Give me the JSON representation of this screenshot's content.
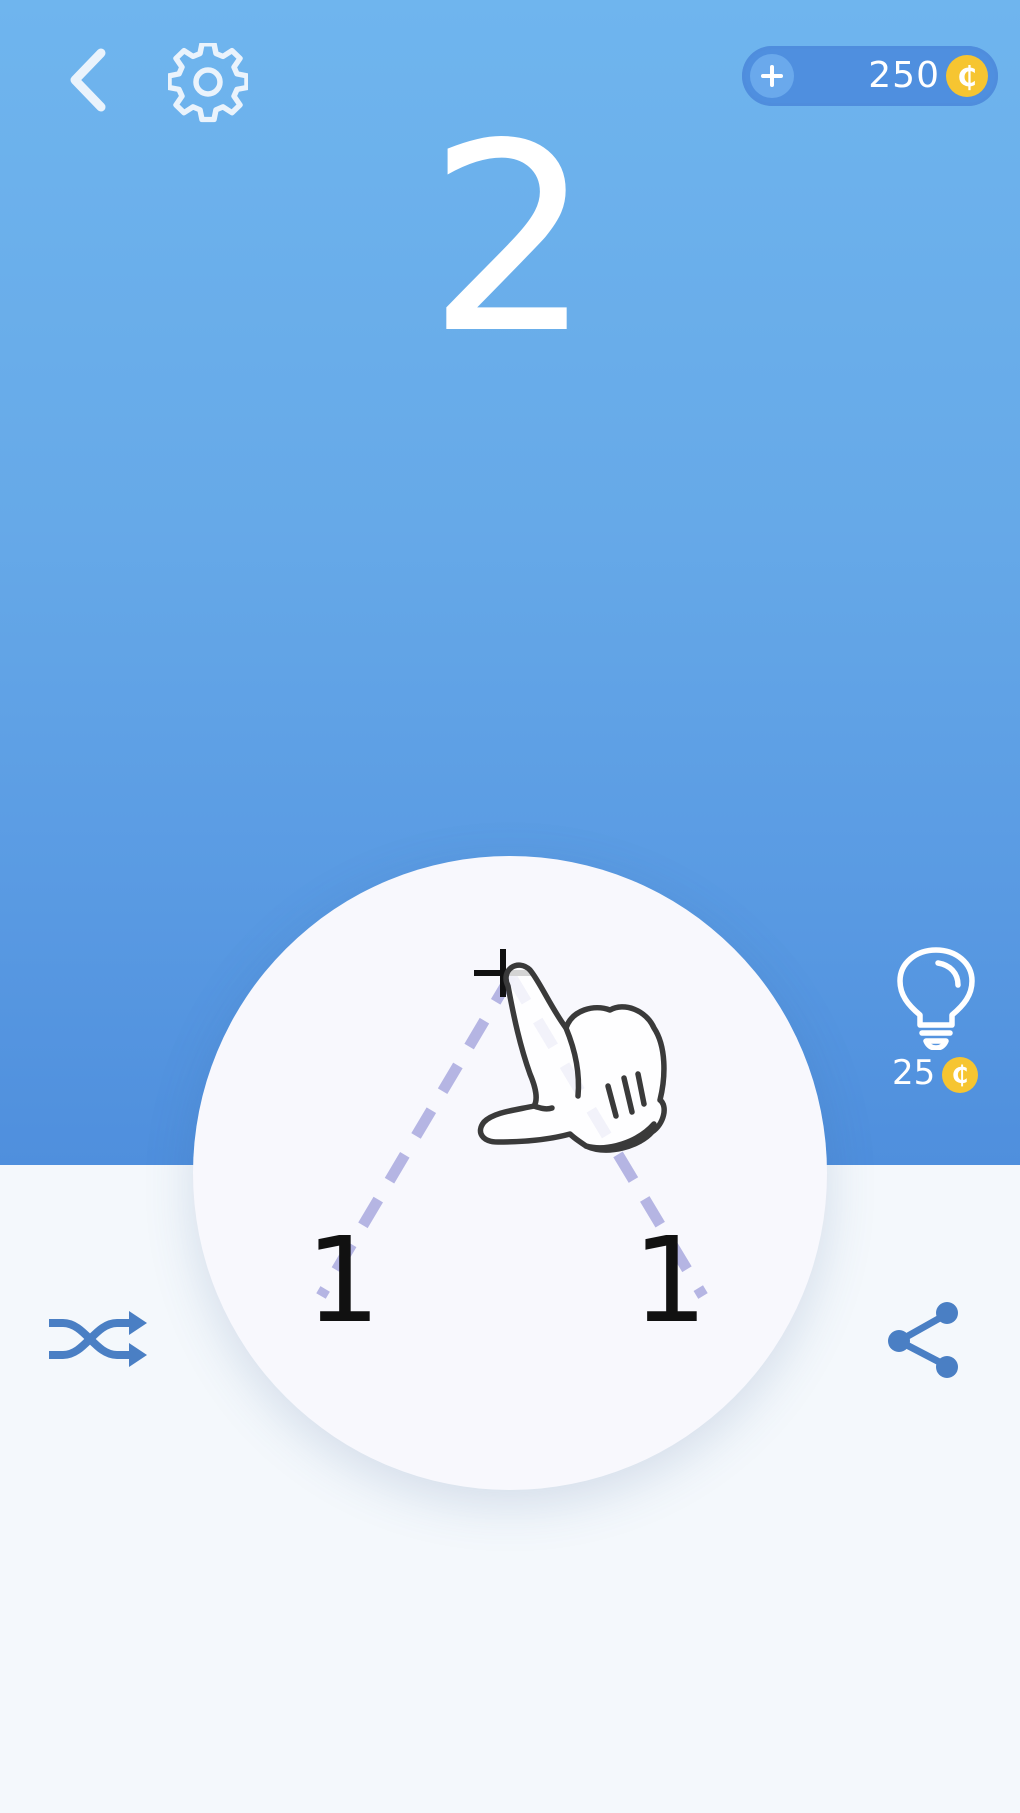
{
  "header": {
    "back_icon": "chevron-left-icon",
    "settings_icon": "gear-icon",
    "coins": {
      "add_icon": "plus-icon",
      "balance": "250",
      "currency_symbol": "₵"
    }
  },
  "puzzle": {
    "target": "2",
    "operator": "+",
    "tiles": [
      "1",
      "1"
    ]
  },
  "hint": {
    "icon": "lightbulb-icon",
    "cost": "25",
    "currency_symbol": "₵"
  },
  "controls": {
    "shuffle_icon": "shuffle-icon",
    "share_icon": "share-icon"
  },
  "tutorial": {
    "hand_icon": "hand-pointer-icon"
  },
  "colors": {
    "top_gradient_start": "#6fb5ee",
    "top_gradient_end": "#4f8fdd",
    "bottom_background": "#f4f8fc",
    "board": "#f8f8fd",
    "coin_gold": "#f6c531",
    "icon_blue": "#4a7fc4",
    "guide_line": "#aaaadf"
  }
}
